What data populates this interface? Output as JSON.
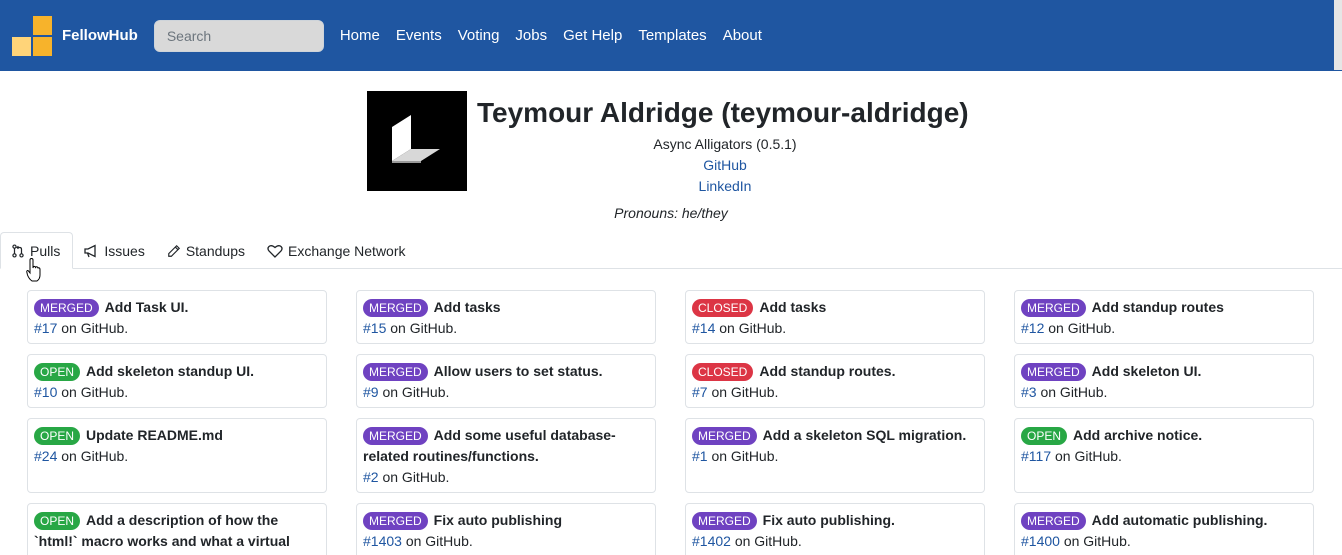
{
  "navbar": {
    "brand": "FellowHub",
    "search_placeholder": "Search",
    "links": [
      "Home",
      "Events",
      "Voting",
      "Jobs",
      "Get Help",
      "Templates",
      "About"
    ]
  },
  "profile": {
    "name": "Teymour Aldridge (teymour-aldridge)",
    "team": "Async Alligators (0.5.1)",
    "github_label": "GitHub",
    "linkedin_label": "LinkedIn",
    "pronouns": "Pronouns: he/they"
  },
  "tabs": [
    {
      "label": "Pulls",
      "icon": "pull-request-icon"
    },
    {
      "label": "Issues",
      "icon": "megaphone-icon"
    },
    {
      "label": "Standups",
      "icon": "pencil-icon"
    },
    {
      "label": "Exchange Network",
      "icon": "heart-icon"
    }
  ],
  "pulls": [
    {
      "status": "MERGED",
      "title": "Add Task UI.",
      "number": "#17",
      "suffix": " on GitHub."
    },
    {
      "status": "MERGED",
      "title": "Add tasks",
      "number": "#15",
      "suffix": " on GitHub."
    },
    {
      "status": "CLOSED",
      "title": "Add tasks",
      "number": "#14",
      "suffix": " on GitHub."
    },
    {
      "status": "MERGED",
      "title": "Add standup routes",
      "number": "#12",
      "suffix": " on GitHub."
    },
    {
      "status": "OPEN",
      "title": "Add skeleton standup UI.",
      "number": "#10",
      "suffix": " on GitHub."
    },
    {
      "status": "MERGED",
      "title": "Allow users to set status.",
      "number": "#9",
      "suffix": " on GitHub."
    },
    {
      "status": "CLOSED",
      "title": "Add standup routes.",
      "number": "#7",
      "suffix": " on GitHub."
    },
    {
      "status": "MERGED",
      "title": "Add skeleton UI.",
      "number": "#3",
      "suffix": " on GitHub."
    },
    {
      "status": "OPEN",
      "title": "Update README.md",
      "number": "#24",
      "suffix": " on GitHub."
    },
    {
      "status": "MERGED",
      "title": "Add some useful database-related routines/functions.",
      "number": "#2",
      "suffix": " on GitHub."
    },
    {
      "status": "MERGED",
      "title": "Add a skeleton SQL migration.",
      "number": "#1",
      "suffix": " on GitHub."
    },
    {
      "status": "OPEN",
      "title": "Add archive notice.",
      "number": "#117",
      "suffix": " on GitHub."
    },
    {
      "status": "OPEN",
      "title": "Add a description of how the `html!` macro works and what a virtual",
      "number": "",
      "suffix": ""
    },
    {
      "status": "MERGED",
      "title": "Fix auto publishing",
      "number": "#1403",
      "suffix": " on GitHub."
    },
    {
      "status": "MERGED",
      "title": "Fix auto publishing.",
      "number": "#1402",
      "suffix": " on GitHub."
    },
    {
      "status": "MERGED",
      "title": "Add automatic publishing.",
      "number": "#1400",
      "suffix": " on GitHub."
    }
  ],
  "colors": {
    "navbar": "#1f56a1",
    "merged": "#6f42c1",
    "open": "#28a745",
    "closed": "#dc3545",
    "link": "#1f56a1"
  }
}
